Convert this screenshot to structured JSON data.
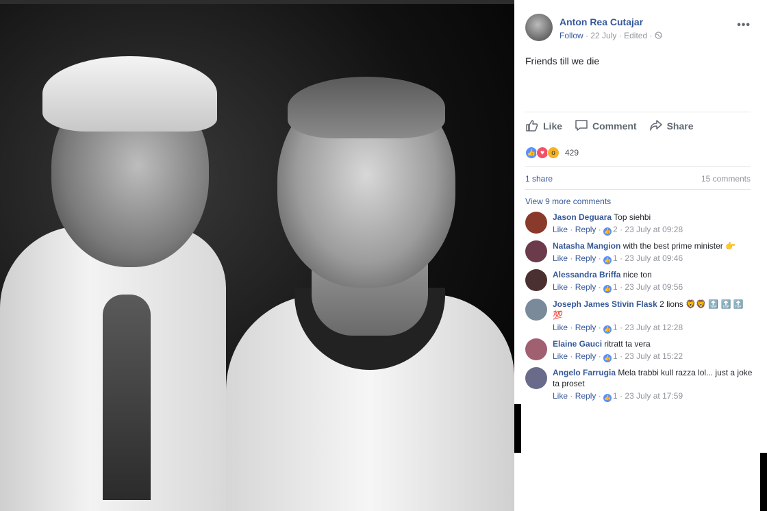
{
  "post": {
    "author": "Anton Rea Cutajar",
    "follow_label": "Follow",
    "date": "22 July",
    "edited_label": "Edited",
    "separator": "·",
    "text": "Friends till we die",
    "more_label": "•••"
  },
  "actions": {
    "like": "Like",
    "comment": "Comment",
    "share": "Share"
  },
  "reactions": {
    "count": "429",
    "types": [
      "like",
      "love",
      "wow"
    ]
  },
  "stats": {
    "shares": "1 share",
    "comments": "15 comments"
  },
  "view_more": "View 9 more comments",
  "comments": [
    {
      "name": "Jason Deguara",
      "text": "Top siehbi",
      "like": "Like",
      "reply": "Reply",
      "likes": "2",
      "time": "23 July at 09:28",
      "avatar_color": "#8a3a2a"
    },
    {
      "name": "Natasha Mangion",
      "text": "with the best prime minister 👉",
      "like": "Like",
      "reply": "Reply",
      "likes": "1",
      "time": "23 July at 09:46",
      "avatar_color": "#6b3b4b"
    },
    {
      "name": "Alessandra Briffa",
      "text": "nice ton",
      "like": "Like",
      "reply": "Reply",
      "likes": "1",
      "time": "23 July at 09:56",
      "avatar_color": "#4a3030"
    },
    {
      "name": "Joseph James Stivin Flask",
      "text": "2 lions 🦁🦁 🔝 🔝 🔝 💯",
      "like": "Like",
      "reply": "Reply",
      "likes": "1",
      "time": "23 July at 12:28",
      "avatar_color": "#7a8a9a"
    },
    {
      "name": "Elaine Gauci",
      "text": "ritratt ta vera",
      "like": "Like",
      "reply": "Reply",
      "likes": "1",
      "time": "23 July at 15:22",
      "avatar_color": "#a06070"
    },
    {
      "name": "Angelo Farrugia",
      "text": "Mela trabbi kull razza lol... just a joke ta proset",
      "like": "Like",
      "reply": "Reply",
      "likes": "1",
      "time": "23 July at 17:59",
      "avatar_color": "#6a6a8a"
    }
  ],
  "colors": {
    "link": "#365899",
    "muted": "#90949c",
    "like_blue": "#5890ff"
  }
}
